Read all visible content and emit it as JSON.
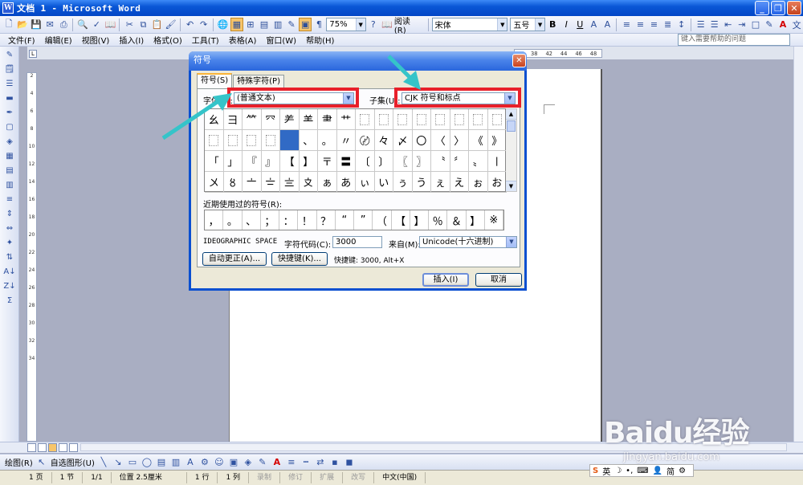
{
  "window": {
    "title": "文档 1 - Microsoft Word",
    "icon": "W"
  },
  "toolbar": {
    "zoom": "75%",
    "reading_label": "阅读(R)",
    "font_name": "宋体",
    "font_size": "五号",
    "bold": "B",
    "italic": "I",
    "underline": "U"
  },
  "menu": {
    "items": [
      "文件(F)",
      "编辑(E)",
      "视图(V)",
      "插入(I)",
      "格式(O)",
      "工具(T)",
      "表格(A)",
      "窗口(W)",
      "帮助(H)"
    ],
    "help_placeholder": "键入需要帮助的问题"
  },
  "ruler": {
    "ticks": [
      "38",
      "42",
      "44",
      "46",
      "48"
    ]
  },
  "vruler": {
    "ticks": [
      "2",
      "4",
      "6",
      "8",
      "10",
      "12",
      "14",
      "16",
      "18",
      "20",
      "22",
      "24",
      "26",
      "28",
      "30",
      "32",
      "34"
    ]
  },
  "dialog": {
    "title": "符号",
    "tabs": [
      "符号(S)",
      "特殊字符(P)"
    ],
    "font_label": "字体(F):",
    "font_value": "(普通文本)",
    "subset_label": "子集(U):",
    "subset_value": "CJK 符号和标点",
    "symbol_rows": [
      [
        "⺓",
        "⺕",
        "⺮",
        "⺳",
        "⺶",
        "⺷",
        "⺻",
        "⺾",
        "",
        "",
        "",
        "",
        "",
        "",
        "",
        ""
      ],
      [
        "",
        "",
        "",
        "",
        "　",
        "、",
        "。",
        "〃",
        "〄",
        "々",
        "〆",
        "〇",
        "〈",
        "〉",
        "《",
        "》"
      ],
      [
        "「",
        "」",
        "『",
        "』",
        "【",
        "】",
        "〒",
        "〓",
        "〔",
        "〕",
        "〖",
        "〗",
        "〝",
        "〞",
        "〟",
        "〡"
      ],
      [
        "〤",
        "〥",
        "〦",
        "〧",
        "〨",
        "〩",
        "ぁ",
        "あ",
        "ぃ",
        "い",
        "ぅ",
        "う",
        "ぇ",
        "え",
        "ぉ",
        "お"
      ]
    ],
    "recent_label": "近期使用过的符号(R):",
    "recent_symbols": [
      "，",
      "。",
      "、",
      "；",
      "：",
      "！",
      "？",
      "“",
      "”",
      "（",
      "【",
      "】",
      "％",
      "＆",
      "】",
      "※"
    ],
    "char_name": "IDEOGRAPHIC SPACE",
    "char_code_label": "字符代码(C):",
    "char_code_value": "3000",
    "from_label": "来自(M):",
    "from_value": "Unicode(十六进制)",
    "autocorrect_button": "自动更正(A)...",
    "shortcut_button": "快捷键(K)...",
    "shortcut_text": "快捷键: 3000, Alt+X",
    "insert_button": "插入(I)",
    "cancel_button": "取消"
  },
  "drawbar": {
    "draw_label": "绘图(R)",
    "autoshape_label": "自选图形(U)"
  },
  "status": {
    "page": "1 页",
    "section": "1 节",
    "pages": "1/1",
    "position": "位置 2.5厘米",
    "line": "1 行",
    "column": "1 列",
    "rec": "录制",
    "trk": "修订",
    "ext": "扩展",
    "ovr": "改写",
    "language": "中文(中国)"
  },
  "ime": {
    "lang": "英",
    "mode": "简"
  },
  "watermark": {
    "brand": "Baidu经验",
    "site": "jingyan.baidu.com"
  },
  "colors": {
    "highlight": "#e8202a",
    "arrow": "#35c4c9",
    "selection": "#316ac5",
    "titlebar": "#0a57d6"
  }
}
